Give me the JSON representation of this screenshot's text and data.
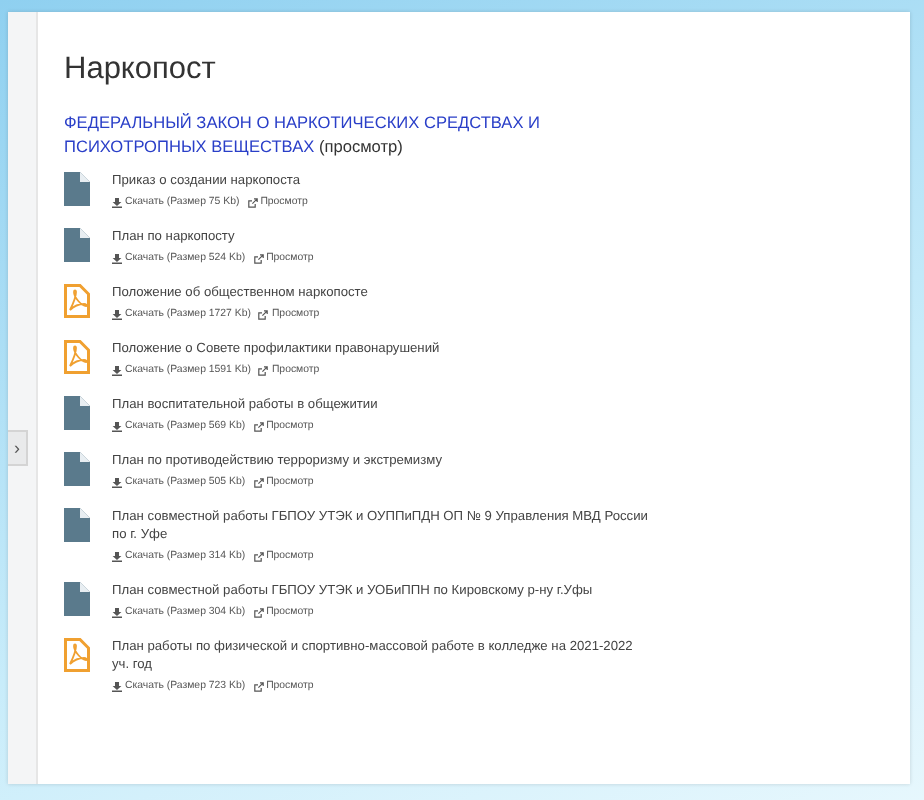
{
  "sidebar_toggle": {
    "label": "›"
  },
  "title": "Наркопост",
  "law": {
    "link": "ФЕДЕРАЛЬНЫЙ ЗАКОН О НАРКОТИЧЕСКИХ СРЕДСТВАХ И ПСИХОТРОПНЫХ ВЕЩЕСТВАХ",
    "view": "(просмотр)"
  },
  "files": [
    {
      "kind": "doc",
      "title": "Приказ о создании наркопоста",
      "download": "Скачать (Размер 75 Kb)",
      "view": "Просмотр"
    },
    {
      "kind": "doc",
      "title": "План по наркопосту",
      "download": "Скачать (Размер 524 Kb)",
      "view": "Просмотр"
    },
    {
      "kind": "pdf",
      "title": "Положение об общественном наркопосте",
      "download": "Скачать (Размер 1727 Kb)",
      "view": "Просмотр"
    },
    {
      "kind": "pdf",
      "title": "Положение о Совете профилактики правонарушений",
      "download": "Скачать (Размер 1591 Kb)",
      "view": "Просмотр"
    },
    {
      "kind": "doc",
      "title": "План воспитательной работы в общежитии",
      "download": "Скачать (Размер 569 Kb)",
      "view": "Просмотр"
    },
    {
      "kind": "doc",
      "title": "План по противодействию терроризму и экстремизму",
      "download": "Скачать (Размер 505 Kb)",
      "view": "Просмотр"
    },
    {
      "kind": "doc",
      "title": "План совместной работы ГБПОУ УТЭК и ОУППиПДН ОП № 9 Управления МВД России по г. Уфе",
      "download": "Скачать (Размер 314 Kb)",
      "view": "Просмотр"
    },
    {
      "kind": "doc",
      "title": "План совместной работы ГБПОУ УТЭК и УОБиППН по Кировскому р-ну г.Уфы",
      "download": "Скачать (Размер 304 Kb)",
      "view": "Просмотр"
    },
    {
      "kind": "pdf",
      "title": "План работы по физической и спортивно-массовой работе в колледже на 2021-2022 уч. год",
      "download": "Скачать (Размер 723 Kb)",
      "view": "Просмотр"
    }
  ]
}
